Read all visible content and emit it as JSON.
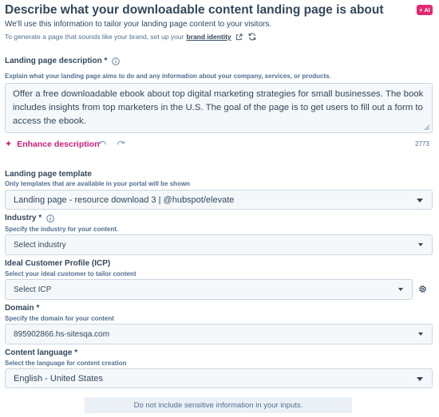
{
  "header": {
    "title": "Describe what your downloadable content landing page is about",
    "ai_badge": "+ AI",
    "subtitle": "We'll use this information to tailor your landing page content to your visitors.",
    "brand_prefix": "To generate a page that sounds like your brand, set up your",
    "brand_link": "brand identity"
  },
  "description": {
    "label": "Landing page description *",
    "help": "Explain what your landing page aims to do and any information about your company, services, or products.",
    "value": "Offer a free downloadable ebook about top digital marketing strategies for small businesses. The book includes insights from top marketers in the U.S. The goal of the page is to get users to fill out a form to access the ebook.",
    "enhance_label": "Enhance description",
    "char_count": "2773"
  },
  "template": {
    "label": "Landing page template",
    "help": "Only templates that are available in your portal will be shown",
    "selected": "Landing page - resource download 3 | @hubspot/elevate"
  },
  "industry": {
    "label": "Industry *",
    "help": "Specify the industry for your content.",
    "selected": "Select industry"
  },
  "icp": {
    "label": "Ideal Customer Profile (ICP)",
    "help": "Select your ideal customer to tailor content",
    "selected": "Select ICP"
  },
  "domain": {
    "label": "Domain *",
    "help": "Specify the domain for your content",
    "selected": "895902866.hs-sitesqa.com"
  },
  "language": {
    "label": "Content language *",
    "help": "Select the language for content creation",
    "selected": "English - United States"
  },
  "footer": {
    "disclaimer": "Do not include sensitive information in your inputs."
  },
  "colors": {
    "text": "#33475b",
    "accent": "#cc1f79",
    "ai_badge": "#e5286f",
    "border": "#cbd6e2",
    "field_bg": "#f5f8fa"
  }
}
